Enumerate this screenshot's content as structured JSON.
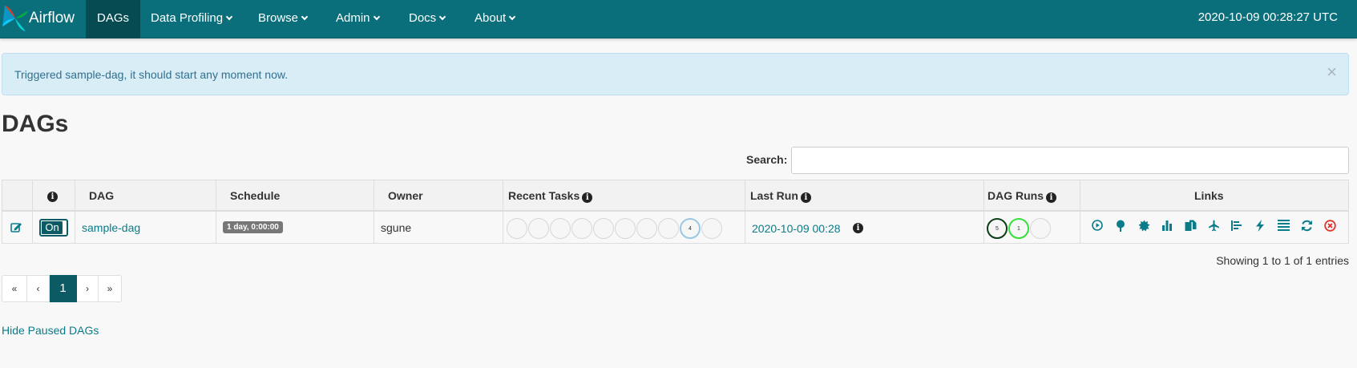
{
  "navbar": {
    "brand": "Airflow",
    "items": [
      {
        "label": "DAGs",
        "dropdown": false,
        "active": true
      },
      {
        "label": "Data Profiling",
        "dropdown": true
      },
      {
        "label": "Browse",
        "dropdown": true
      },
      {
        "label": "Admin",
        "dropdown": true
      },
      {
        "label": "Docs",
        "dropdown": true
      },
      {
        "label": "About",
        "dropdown": true
      }
    ],
    "clock": "2020-10-09 00:28:27 UTC"
  },
  "alert": {
    "message": "Triggered sample-dag, it should start any moment now.",
    "close": "×"
  },
  "page_title": "DAGs",
  "search": {
    "label": "Search:",
    "value": ""
  },
  "table": {
    "headers": {
      "info": "i",
      "dag": "DAG",
      "schedule": "Schedule",
      "owner": "Owner",
      "recent_tasks": "Recent Tasks",
      "last_run": "Last Run",
      "dag_runs": "DAG Runs",
      "links": "Links"
    },
    "rows": [
      {
        "toggle": "On",
        "dag_id": "sample-dag",
        "schedule": "1 day, 0:00:00",
        "owner": "sgune",
        "recent_tasks": [
          "",
          "",
          "",
          "",
          "",
          "",
          "",
          "",
          "4",
          ""
        ],
        "recent_task_colors": [
          "#d7d7d7",
          "#d7d7d7",
          "#d7d7d7",
          "#d7d7d7",
          "#d7d7d7",
          "#d7d7d7",
          "#d7d7d7",
          "#d7d7d7",
          "#9ac8e3",
          "#d7d7d7"
        ],
        "last_run": "2020-10-09 00:28",
        "dag_runs": [
          "5",
          "1",
          ""
        ],
        "dag_run_colors": [
          "#0b3d17",
          "#36e03a",
          "#d7d7d7"
        ]
      }
    ],
    "link_icons": [
      "trigger-dag-icon",
      "tree-view-icon",
      "graph-view-icon",
      "task-duration-icon",
      "task-tries-icon",
      "landing-times-icon",
      "gantt-icon",
      "code-view-icon",
      "logs-icon",
      "refresh-icon",
      "delete-dag-icon"
    ]
  },
  "entries": "Showing 1 to 1 of 1 entries",
  "pagination": [
    "«",
    "‹",
    "1",
    "›",
    "»"
  ],
  "hide_paused": "Hide Paused DAGs",
  "colors": {
    "navbar": "#0a6f7b",
    "link": "#0a7c89",
    "active": "#0c5a63",
    "alert_bg": "#d8edf6"
  }
}
